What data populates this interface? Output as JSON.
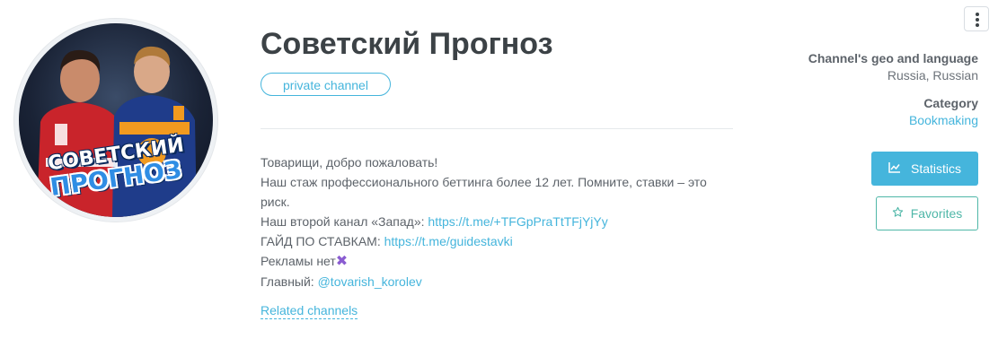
{
  "channel": {
    "title": "Советский Прогноз",
    "badge": "private channel",
    "avatar_text_line1": "СОВЕТСКИЙ",
    "avatar_text_line2": "ПРОГНОЗ",
    "description": {
      "line1": "Товарищи, добро пожаловать!",
      "line2": "Наш стаж профессионального беттинга более 12 лет. Помните, ставки – это",
      "line3": "риск.",
      "line4_text": "Наш второй канал «Запад»: ",
      "line4_link": "https://t.me/+TFGpPraTtTFjYjYy",
      "line5_text": "ГАЙД ПО СТАВКАМ: ",
      "line5_link": "https://t.me/guidestavki",
      "line6_text": "Рекламы нет",
      "line6_emoji": "✖",
      "line7_text": "Главный: ",
      "line7_link": "@tovarish_korolev"
    },
    "related_link": "Related channels"
  },
  "sidebar": {
    "geo_label": "Channel's geo and language",
    "geo_value": "Russia, Russian",
    "category_label": "Category",
    "category_value": "Bookmaking",
    "statistics_button": "Statistics",
    "favorites_button": "Favorites"
  },
  "colors": {
    "accent": "#45b5dc",
    "favorites": "#4fb7a8",
    "title": "#3c4246"
  },
  "icons": {
    "menu": "kebab-menu-icon",
    "statistics": "chart-line-icon",
    "favorites": "star-outline-icon"
  }
}
